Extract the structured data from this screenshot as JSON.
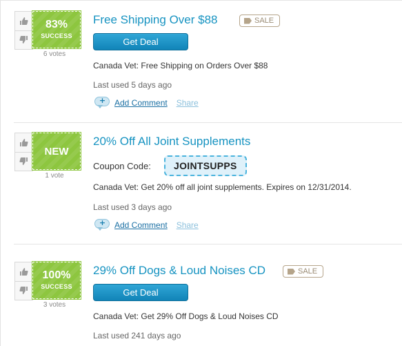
{
  "coupons": [
    {
      "type": "deal",
      "success_pct": "83%",
      "success_label": "SUCCESS",
      "votes": "6 votes",
      "title": "Free Shipping Over $88",
      "tag": "SALE",
      "button_label": "Get Deal",
      "description": "Canada Vet: Free Shipping on Orders Over $88",
      "last_used": "Last used 5 days ago",
      "add_comment": "Add Comment",
      "share": "Share"
    },
    {
      "type": "code",
      "badge_text": "NEW",
      "votes": "1 vote",
      "title": "20% Off All Joint Supplements",
      "code_label": "Coupon Code:",
      "code": "JOINTSUPPS",
      "description": "Canada Vet: Get 20% off all joint supplements. Expires on 12/31/2014.",
      "last_used": "Last used 3 days ago",
      "add_comment": "Add Comment",
      "share": "Share"
    },
    {
      "type": "deal",
      "success_pct": "100%",
      "success_label": "SUCCESS",
      "votes": "3 votes",
      "title": "29% Off Dogs & Loud Noises CD",
      "tag": "SALE",
      "button_label": "Get Deal",
      "description": "Canada Vet: Get 29% Off Dogs & Loud Noises CD",
      "last_used": "Last used 241 days ago"
    }
  ],
  "colors": {
    "title": "#1693c1",
    "badge_green": "#8dc63f",
    "button_blue": "#1a95c9",
    "code_border": "#49b3dd"
  }
}
